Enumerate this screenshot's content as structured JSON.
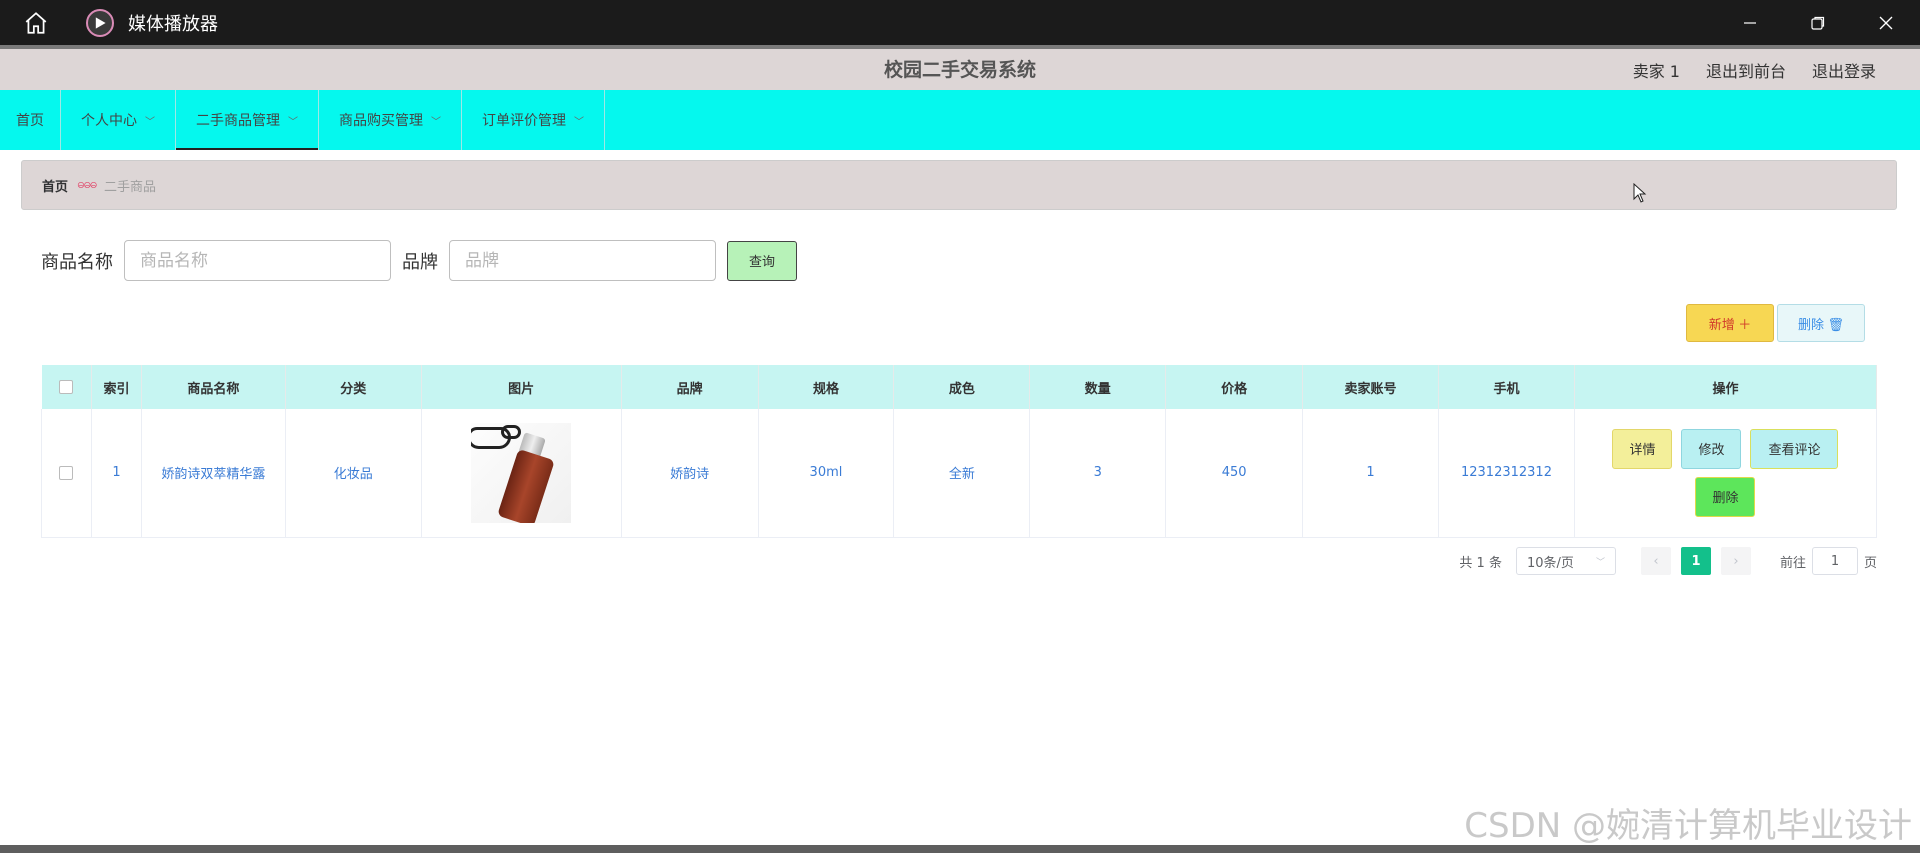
{
  "window": {
    "title": "媒体播放器"
  },
  "header": {
    "title": "校园二手交易系统",
    "user": "卖家 1",
    "back_to_front": "退出到前台",
    "logout": "退出登录"
  },
  "nav": {
    "items": [
      {
        "label": "首页"
      },
      {
        "label": "个人中心"
      },
      {
        "label": "二手商品管理"
      },
      {
        "label": "商品购买管理"
      },
      {
        "label": "订单评价管理"
      }
    ]
  },
  "breadcrumb": {
    "home": "首页",
    "separator": "ဓဓဓ",
    "current": "二手商品"
  },
  "search": {
    "name_label": "商品名称",
    "name_placeholder": "商品名称",
    "brand_label": "品牌",
    "brand_placeholder": "品牌",
    "query_button": "查询"
  },
  "actions": {
    "add": "新增 ＋",
    "delete": "删除 🗑"
  },
  "table": {
    "headers": [
      "索引",
      "商品名称",
      "分类",
      "图片",
      "品牌",
      "规格",
      "成色",
      "数量",
      "价格",
      "卖家账号",
      "手机",
      "操作"
    ],
    "rows": [
      {
        "index": "1",
        "name": "娇韵诗双萃精华露",
        "category": "化妆品",
        "brand": "娇韵诗",
        "spec": "30ml",
        "condition": "全新",
        "quantity": "3",
        "price": "450",
        "seller": "1",
        "phone": "12312312312",
        "ops": {
          "detail": "详情",
          "edit": "修改",
          "review": "查看评论",
          "delete": "删除"
        }
      }
    ]
  },
  "pagination": {
    "total": "共 1 条",
    "page_size": "10条/页",
    "current_page": "1",
    "goto_prefix": "前往",
    "goto_value": "1",
    "goto_suffix": "页"
  },
  "watermark": "CSDN @婉清计算机毕业设计",
  "colors": {
    "nav_bg": "#05f8ee",
    "table_header_bg": "#c6f5f2",
    "active_page": "#13c08b",
    "add_button": "#f7d753",
    "query_button": "#b7f2b8"
  }
}
